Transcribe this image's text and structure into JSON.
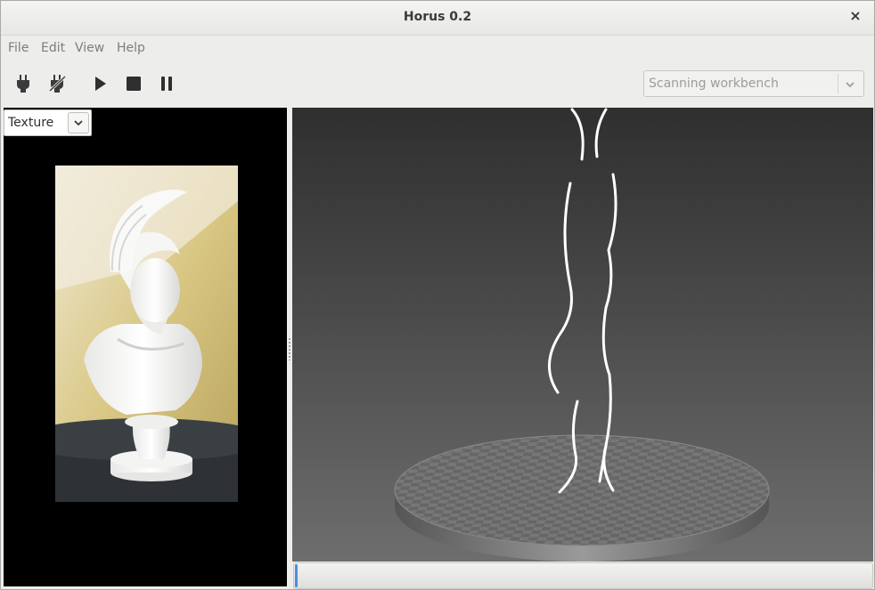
{
  "window": {
    "title": "Horus 0.2",
    "close_glyph": "×"
  },
  "menu": {
    "file": "File",
    "edit": "Edit",
    "view": "View",
    "help": "Help"
  },
  "toolbar": {
    "tools": [
      {
        "name": "connect-icon"
      },
      {
        "name": "disconnect-icon"
      },
      {
        "name": "play-icon"
      },
      {
        "name": "stop-icon"
      },
      {
        "name": "pause-icon"
      }
    ],
    "workbench": {
      "value": "Scanning workbench"
    }
  },
  "left_panel": {
    "view_mode": "Texture"
  },
  "progress": {
    "fraction": 0.005
  },
  "colors": {
    "accent": "#4a90d9",
    "viewport_top": "#2f2f2f",
    "viewport_bottom": "#6e6e6e"
  }
}
